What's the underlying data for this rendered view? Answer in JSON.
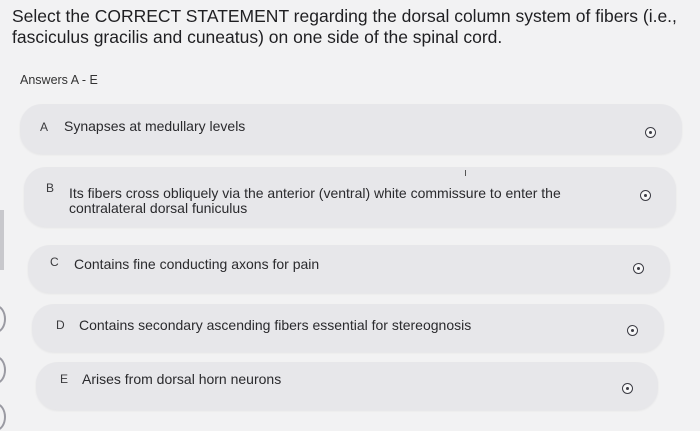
{
  "question": {
    "text": "Select the CORRECT STATEMENT regarding the dorsal column system of fibers (i.e., fasciculus gracilis and cuneatus) on one side of the spinal cord."
  },
  "answers_label": "Answers A - E",
  "options": [
    {
      "letter": "A",
      "text": "Synapses at medullary levels"
    },
    {
      "letter": "B",
      "text": "Its fibers cross obliquely via the anterior (ventral) white commissure to enter the contralateral dorsal funiculus"
    },
    {
      "letter": "C",
      "text": "Contains fine conducting axons for pain"
    },
    {
      "letter": "D",
      "text": "Contains secondary ascending fibers essential for stereognosis"
    },
    {
      "letter": "E",
      "text": "Arises from dorsal horn neurons"
    }
  ],
  "radio_icon": "radio-button-icon"
}
